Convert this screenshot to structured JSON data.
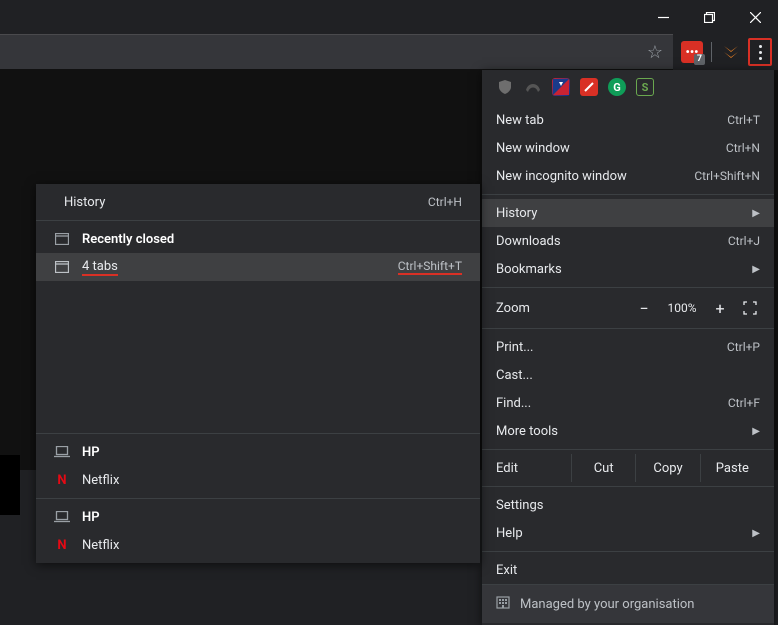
{
  "window": {
    "minimize": "—",
    "maximize": "❐",
    "close": "✕"
  },
  "toolbar_ext": {
    "badge": "7"
  },
  "menu": {
    "new_tab": "New tab",
    "new_tab_sc": "Ctrl+T",
    "new_window": "New window",
    "new_window_sc": "Ctrl+N",
    "incognito": "New incognito window",
    "incognito_sc": "Ctrl+Shift+N",
    "history": "History",
    "downloads": "Downloads",
    "downloads_sc": "Ctrl+J",
    "bookmarks": "Bookmarks",
    "zoom": "Zoom",
    "zoom_minus": "−",
    "zoom_val": "100%",
    "zoom_plus": "+",
    "print": "Print...",
    "print_sc": "Ctrl+P",
    "cast": "Cast...",
    "find": "Find...",
    "find_sc": "Ctrl+F",
    "more_tools": "More tools",
    "edit": "Edit",
    "cut": "Cut",
    "copy": "Copy",
    "paste": "Paste",
    "settings": "Settings",
    "help": "Help",
    "exit": "Exit",
    "managed": "Managed by your organisation"
  },
  "submenu": {
    "history": "History",
    "history_sc": "Ctrl+H",
    "recently_closed": "Recently closed",
    "four_tabs": "4 tabs",
    "four_tabs_sc": "Ctrl+Shift+T",
    "hp": "HP",
    "netflix": "Netflix",
    "netflix_icon": "N"
  }
}
